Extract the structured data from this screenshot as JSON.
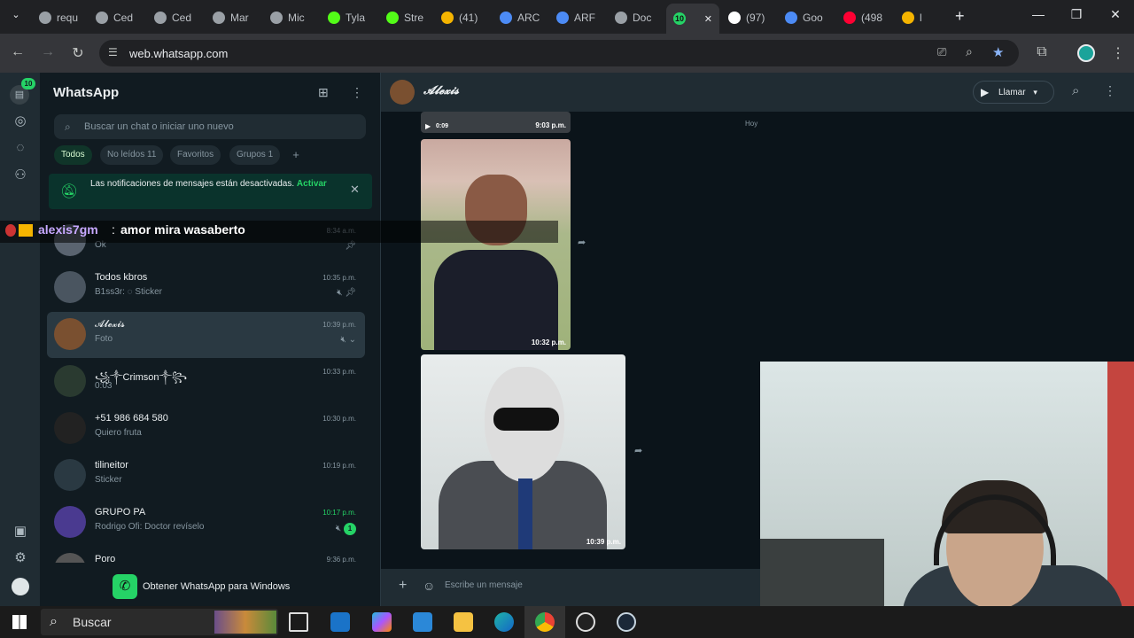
{
  "browser": {
    "tabs": [
      {
        "label": "requ",
        "color": "#9aa0a6"
      },
      {
        "label": "Ced",
        "color": "#9aa0a6"
      },
      {
        "label": "Ced",
        "color": "#9aa0a6"
      },
      {
        "label": "Mar",
        "color": "#9aa0a6"
      },
      {
        "label": "Mic",
        "color": "#9aa0a6"
      },
      {
        "label": "Tyla",
        "color": "#53fc18"
      },
      {
        "label": "Stre",
        "color": "#53fc18"
      },
      {
        "label": "(41)",
        "color": "#f5b400"
      },
      {
        "label": "ARC",
        "color": "#4c8bf5"
      },
      {
        "label": "ARF",
        "color": "#4c8bf5"
      },
      {
        "label": "Doc",
        "color": "#9aa0a6"
      },
      {
        "label": "10",
        "color": "#25d366",
        "active": true
      },
      {
        "label": "(97)",
        "color": "#ffffff"
      },
      {
        "label": "Goo",
        "color": "#4c8bf5"
      },
      {
        "label": "(498",
        "color": "#ff0033"
      },
      {
        "label": "l",
        "color": "#f5b400"
      }
    ],
    "url": "web.whatsapp.com"
  },
  "whatsapp": {
    "rail_badge": "10",
    "title": "WhatsApp",
    "search_placeholder": "Buscar un chat o iniciar uno nuevo",
    "filters": [
      "Todos",
      "No leídos 11",
      "Favoritos",
      "Grupos 1"
    ],
    "notification": {
      "text": "Las notificaciones de mensajes están desactivadas.",
      "action": "Activar"
    },
    "chats": [
      {
        "name": "",
        "msg": "Ok",
        "time": "8:34 a.m.",
        "icon": "pin",
        "avatar": "#5a6470"
      },
      {
        "name": "Todos kbros",
        "msg": "B1ss3r: ◌ Sticker",
        "time": "10:35 p.m.",
        "icon": "mute-pin",
        "avatar": "#4a5560"
      },
      {
        "name": "𝓐𝓵𝓮𝔁𝓲𝓼",
        "msg": "Foto",
        "time": "10:39 p.m.",
        "icon": "mute",
        "avatar": "#7a5030",
        "selected": true
      },
      {
        "name": "꧁༒Crimson༒꧂",
        "msg": "0:03",
        "time": "10:33 p.m.",
        "icon": "",
        "avatar": "#2a3a30"
      },
      {
        "name": "+51 986 684 580",
        "msg": "Quiero fruta",
        "time": "10:30 p.m.",
        "icon": "",
        "avatar": "#222"
      },
      {
        "name": "tilineitor",
        "msg": "Sticker",
        "time": "10:19 p.m.",
        "icon": "",
        "avatar": "#2a3942"
      },
      {
        "name": "GRUPO PA",
        "msg": "Rodrigo Ofi: Doctor revíselo",
        "time": "10:17 p.m.",
        "icon": "mute-unread",
        "avatar": "#4a3a90"
      },
      {
        "name": "Poro",
        "msg": "",
        "time": "9:36 p.m.",
        "icon": "",
        "avatar": "#555"
      }
    ],
    "unread_count": "1",
    "get_app": "Obtener WhatsApp para Windows",
    "contact": "𝓐𝓵𝓮𝔁𝓲𝓼",
    "call_label": "Llamar",
    "day_label": "Hoy",
    "video_meta": {
      "duration": "0:09",
      "time": "9:03 p.m."
    },
    "photo1_time": "10:32 p.m.",
    "photo2_time": "10:39 p.m.",
    "input_placeholder": "Escribe un mensaje"
  },
  "stream_overlay": {
    "user": "alexis7gm",
    "sep": ":",
    "message": "amor mira wasaberto"
  },
  "taskbar": {
    "search_label": "Buscar"
  }
}
